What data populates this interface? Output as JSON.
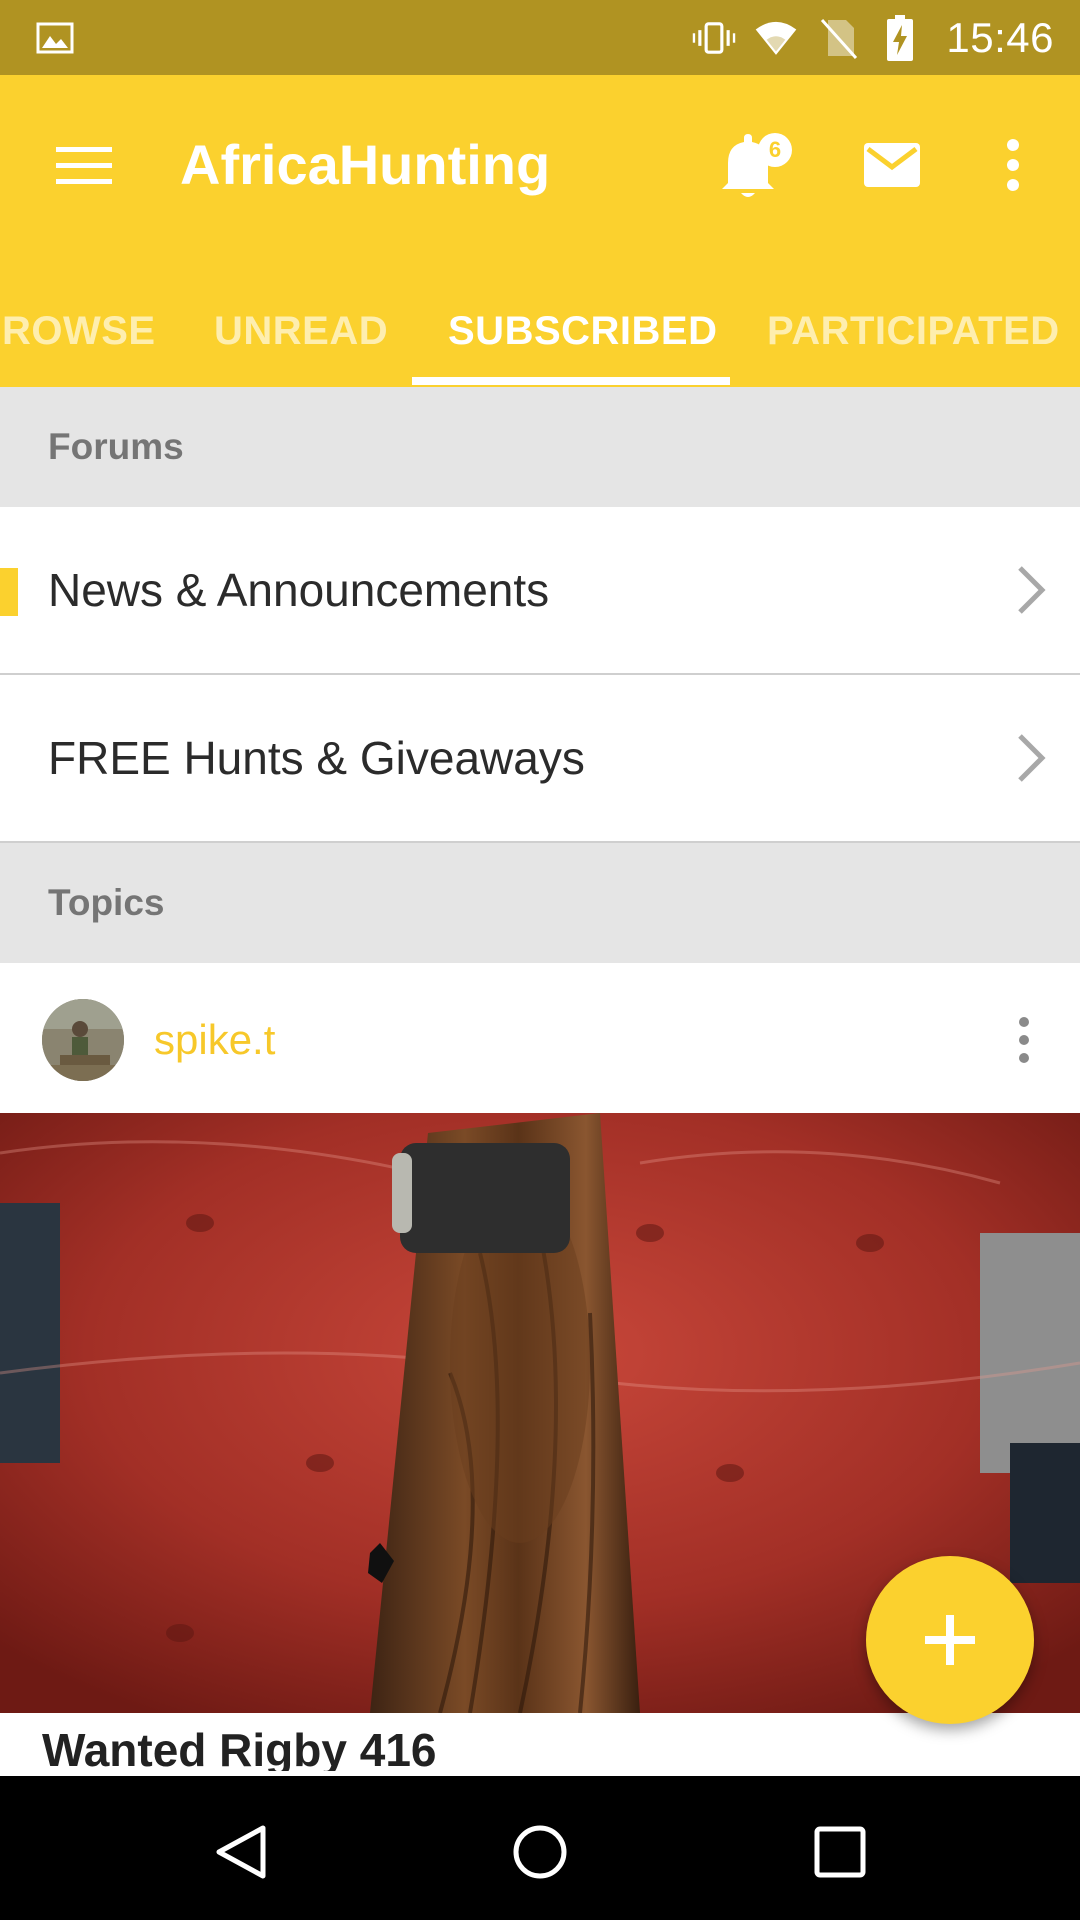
{
  "status_bar": {
    "time": "15:46",
    "icons": [
      "image-icon",
      "vibrate-icon",
      "wifi-icon",
      "no-sim-icon",
      "battery-charging-icon"
    ]
  },
  "app_bar": {
    "title": "AfricaHunting",
    "notification_count": "6",
    "icons": [
      "menu-icon",
      "bell-icon",
      "mail-icon",
      "more-vert-icon"
    ],
    "accent_color": "#FBD12E"
  },
  "tabs": [
    {
      "label": "ROWSE"
    },
    {
      "label": "UNREAD"
    },
    {
      "label": "SUBSCRIBED"
    },
    {
      "label": "PARTICIPATED"
    }
  ],
  "active_tab": "SUBSCRIBED",
  "sections": {
    "forums": {
      "header": "Forums",
      "items": [
        {
          "label": "News & Announcements"
        },
        {
          "label": "FREE Hunts & Giveaways"
        }
      ]
    },
    "topics": {
      "header": "Topics",
      "items": [
        {
          "author": "spike.t",
          "title": "Wanted Rigby 416"
        }
      ]
    }
  },
  "fab": {
    "icon": "plus-icon"
  },
  "nav_bar": {
    "icons": [
      "back-icon",
      "home-icon",
      "recents-icon"
    ]
  }
}
